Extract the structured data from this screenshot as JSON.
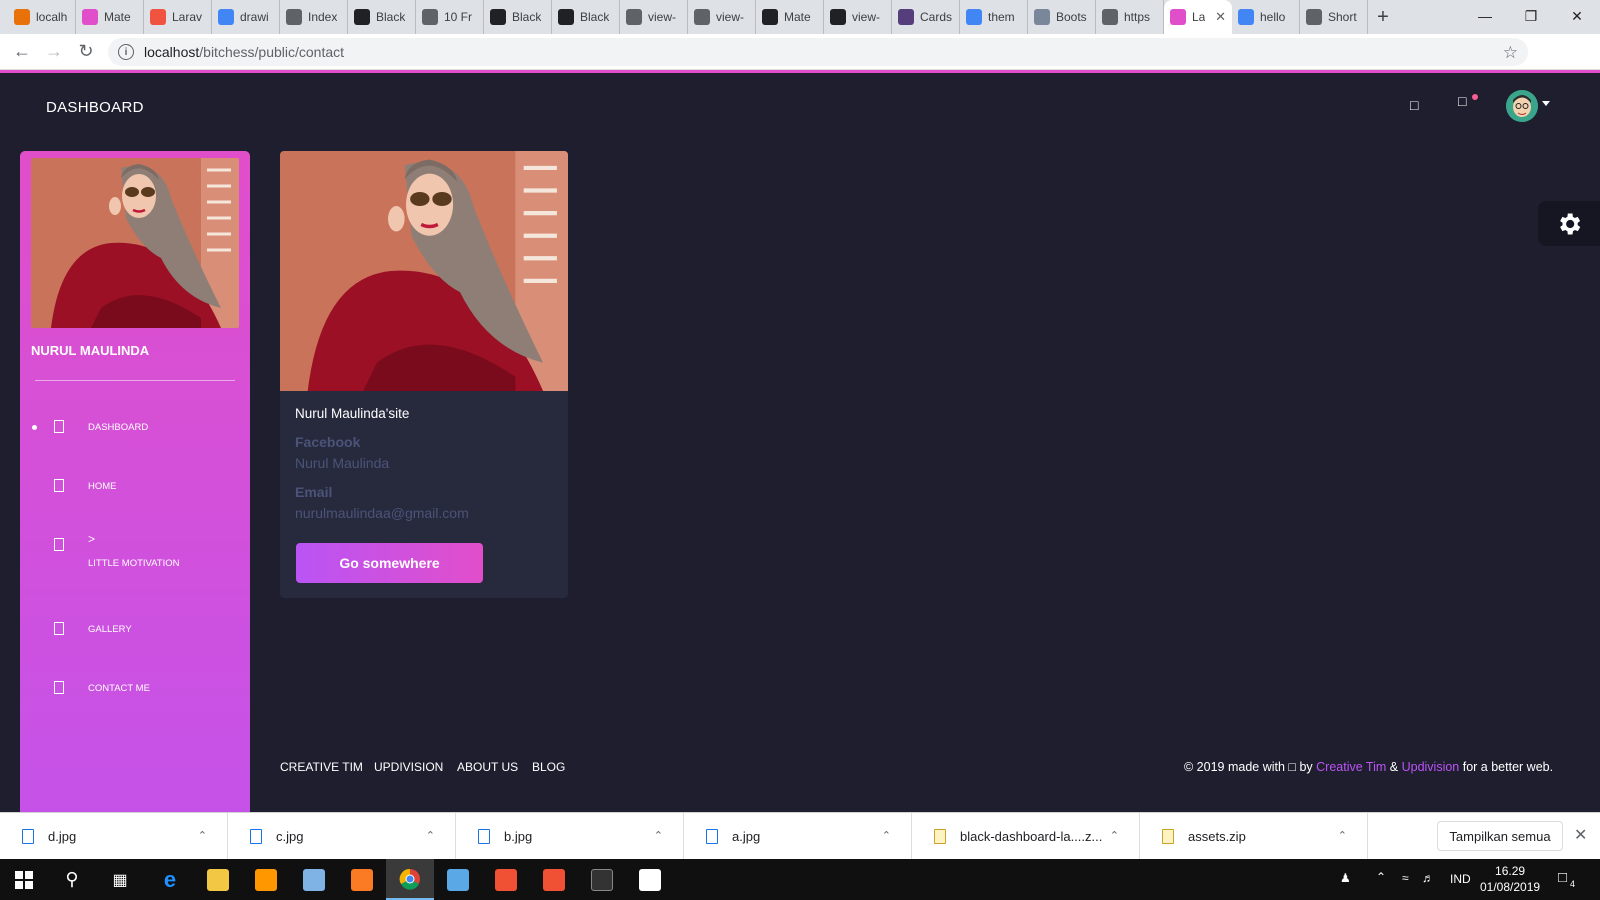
{
  "browser": {
    "tabs": [
      {
        "label": "localh",
        "fav_color": "#e8710a"
      },
      {
        "label": "Mate",
        "fav_color": "#e14eca"
      },
      {
        "label": "Larav",
        "fav_color": "#f05340"
      },
      {
        "label": "drawi",
        "fav_color": "#4285f4"
      },
      {
        "label": "Index",
        "fav_color": "#5f6368"
      },
      {
        "label": "Black",
        "fav_color": "#202124"
      },
      {
        "label": "10 Fr",
        "fav_color": "#5f6368"
      },
      {
        "label": "Black",
        "fav_color": "#202124"
      },
      {
        "label": "Black",
        "fav_color": "#202124"
      },
      {
        "label": "view-",
        "fav_color": "#5f6368"
      },
      {
        "label": "view-",
        "fav_color": "#5f6368"
      },
      {
        "label": "Mate",
        "fav_color": "#202124"
      },
      {
        "label": "view-",
        "fav_color": "#202124"
      },
      {
        "label": "Cards",
        "fav_color": "#563d7c"
      },
      {
        "label": "them",
        "fav_color": "#4285f4"
      },
      {
        "label": "Boots",
        "fav_color": "#7a869a"
      },
      {
        "label": "https",
        "fav_color": "#5f6368"
      },
      {
        "label": "La",
        "fav_color": "#e14eca",
        "active": true
      },
      {
        "label": "hello",
        "fav_color": "#4285f4"
      },
      {
        "label": "Short",
        "fav_color": "#5f6368"
      }
    ],
    "url_host": "localhost",
    "url_path": "/bitchess/public/contact"
  },
  "topbar": {
    "brand": "DASHBOARD"
  },
  "sidebar": {
    "name": "NURUL MAULINDA",
    "items": [
      {
        "label": "DASHBOARD",
        "active": true
      },
      {
        "label": "HOME"
      },
      {
        "label": ">",
        "sub": "LITTLE MOTIVATION"
      },
      {
        "label": "GALLERY"
      },
      {
        "label": "CONTACT ME"
      }
    ]
  },
  "card": {
    "title": "Nurul Maulinda'site",
    "facebook_label": "Facebook",
    "facebook_value": "Nurul Maulinda",
    "email_label": "Email",
    "email_value": "nurulmaulindaa@gmail.com",
    "button": "Go somewhere"
  },
  "footer": {
    "links": [
      "CREATIVE TIM",
      "UPDIVISION",
      "ABOUT US",
      "BLOG"
    ],
    "copy_pre": "© 2019 made with ",
    "copy_by": " by ",
    "creative_tim": "Creative Tim",
    "amp": " & ",
    "updivision": "Updivision",
    "copy_post": " for a better web."
  },
  "downloads": {
    "files": [
      {
        "name": "d.jpg",
        "kind": "image"
      },
      {
        "name": "c.jpg",
        "kind": "image"
      },
      {
        "name": "b.jpg",
        "kind": "image"
      },
      {
        "name": "a.jpg",
        "kind": "image"
      },
      {
        "name": "black-dashboard-la....z...",
        "kind": "zip"
      },
      {
        "name": "assets.zip",
        "kind": "zip"
      }
    ],
    "show_all": "Tampilkan semua"
  },
  "taskbar": {
    "lang": "IND",
    "time": "16.29",
    "date": "01/08/2019",
    "notif_count": "4"
  },
  "colors": {
    "accent": "#e14eca",
    "accent2": "#ba54f5",
    "bg": "#1e1e2f",
    "card": "#27293d"
  }
}
